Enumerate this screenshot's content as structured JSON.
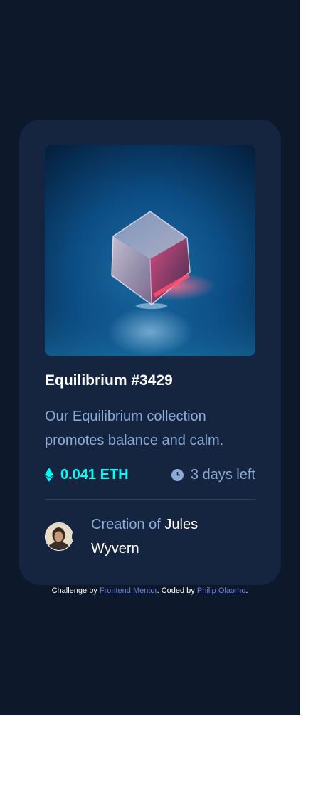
{
  "card": {
    "title": "Equilibrium #3429",
    "description": "Our Equilibrium collection promotes balance and calm.",
    "price": "0.041 ETH",
    "time_left": "3 days left",
    "creator_prefix": "Creation of",
    "creator_name": "Jules Wyvern",
    "hero_image": "equilibrium-cube",
    "avatar_image": "jules-wyvern-avatar"
  },
  "icons": {
    "price": "ethereum-icon",
    "time": "clock-icon"
  },
  "attribution": {
    "prefix": "Challenge by",
    "challenge_link": "Frontend Mentor",
    "middle": ". Coded by",
    "author_link": "Philip Olaomo",
    "suffix": "."
  },
  "colors": {
    "page_background": "#0d192b",
    "card_background": "#15253f",
    "accent_cyan": "#00fff8",
    "soft_blue": "#8bacd9",
    "divider": "#2e405a",
    "link": "#6f7fd6"
  }
}
